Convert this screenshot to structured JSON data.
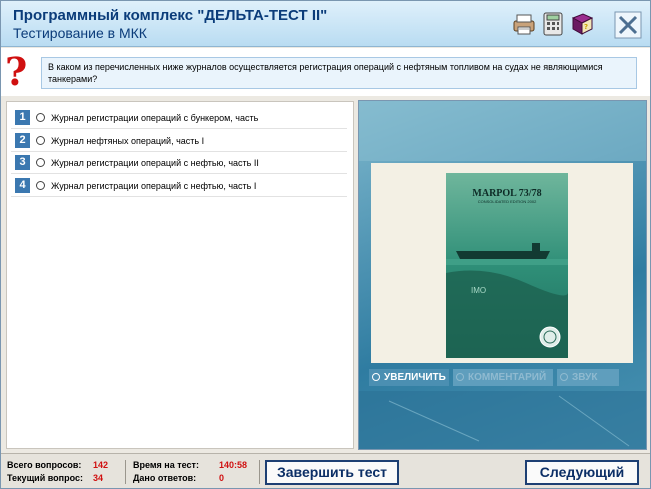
{
  "header": {
    "title": "Программный комплекс \"ДЕЛЬТА-ТЕСТ II\"",
    "subtitle": "Тестирование в МКК",
    "icons": [
      "printer-icon",
      "calculator-icon",
      "book-icon",
      "close-icon"
    ]
  },
  "question": {
    "text": "В каком из перечисленных ниже журналов осуществляется регистрация операций с нефтяным топливом на судах не являющимися танкерами?"
  },
  "answers": [
    {
      "number": "1",
      "text": "Журнал регистрации операций с бункером, часть"
    },
    {
      "number": "2",
      "text": "Журнал нефтяных операций, часть I"
    },
    {
      "number": "3",
      "text": "Журнал регистрации операций с нефтью, часть II"
    },
    {
      "number": "4",
      "text": "Журнал регистрации операций с нефтью, часть I"
    }
  ],
  "image_panel": {
    "book_title": "MARPOL 73/78",
    "book_subtitle": "CONSOLIDATED EDITION 2002",
    "book_logo": "IMO",
    "zoom_label": "УВЕЛИЧИТЬ",
    "comment_label": "КОММЕНТАРИЙ",
    "sound_label": "ЗВУК"
  },
  "footer": {
    "total_label": "Всего вопросов:",
    "total_value": "142",
    "current_label": "Текущий вопрос:",
    "current_value": "34",
    "time_label": "Время на тест:",
    "time_value": "140:58",
    "answered_label": "Дано ответов:",
    "answered_value": "0",
    "finish_label": "Завершить тест",
    "next_label": "Следующий"
  },
  "colors": {
    "title": "#0b3c7a",
    "accent_red": "#d01010",
    "number_badge": "#3b78b0"
  }
}
